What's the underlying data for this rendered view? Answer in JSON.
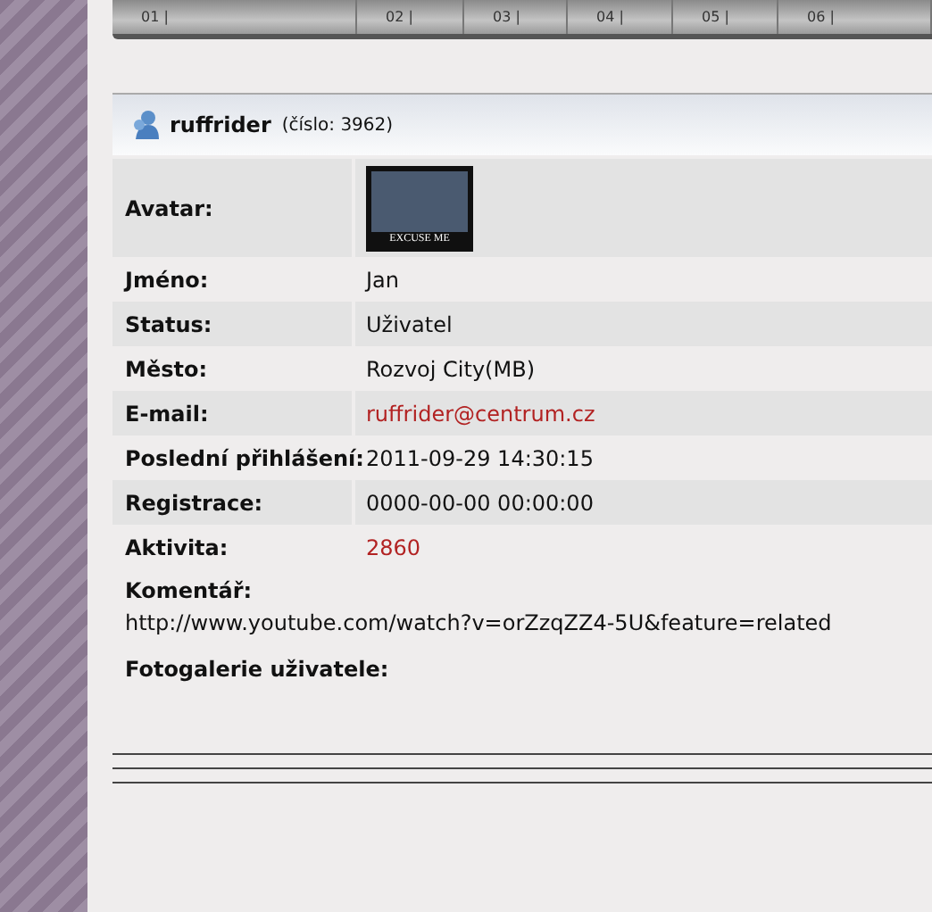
{
  "nav": [
    {
      "number": "01 |"
    },
    {
      "number": "02 |"
    },
    {
      "number": "03 |"
    },
    {
      "number": "04 |"
    },
    {
      "number": "05 |"
    },
    {
      "number": "06 |"
    }
  ],
  "profile": {
    "username": "ruffrider",
    "number_label": "(číslo: 3962)"
  },
  "fields": [
    {
      "kind": "avatar",
      "label": "Avatar:",
      "caption": "EXCUSE ME"
    },
    {
      "kind": "text",
      "label": "Jméno:",
      "value": "Jan"
    },
    {
      "kind": "text",
      "label": "Status:",
      "value": "Uživatel"
    },
    {
      "kind": "text",
      "label": "Město:",
      "value": "Rozvoj City(MB)"
    },
    {
      "kind": "link",
      "label": "E-mail:",
      "value": "ruffrider@centrum.cz"
    },
    {
      "kind": "text",
      "label": "Poslední přihlášení:",
      "value": "2011-09-29 14:30:15"
    },
    {
      "kind": "text",
      "label": "Registrace:",
      "value": "0000-00-00 00:00:00"
    },
    {
      "kind": "highlight",
      "label": "Aktivita:",
      "value": "2860"
    }
  ],
  "comment": {
    "label": "Komentář:",
    "value": "http://www.youtube.com/watch?v=orZzqZZ4-5U&feature=related"
  },
  "gallery": {
    "label": "Fotogalerie uživatele:"
  }
}
